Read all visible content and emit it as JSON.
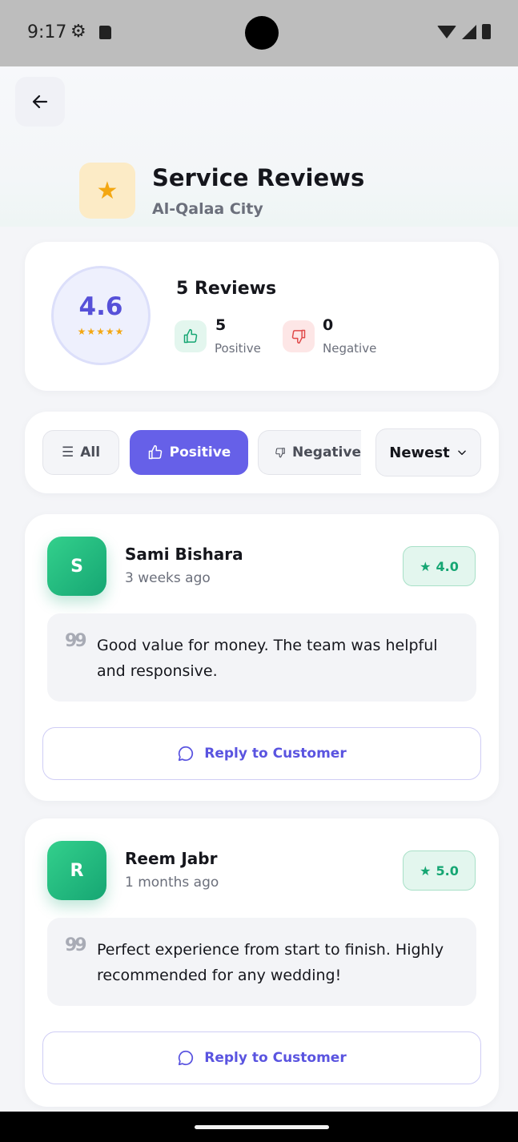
{
  "status_bar": {
    "time": "9:17"
  },
  "header": {
    "title": "Service Reviews",
    "subtitle": "Al-Qalaa City"
  },
  "summary": {
    "rating": "4.6",
    "stars": "★★★★★",
    "reviews_count": "5 Reviews",
    "positive_count": "5",
    "positive_label": "Positive",
    "negative_count": "0",
    "negative_label": "Negative"
  },
  "filters": {
    "all_label": "All",
    "positive_label": "Positive",
    "negative_label": "Negative",
    "sort_label": "Newest",
    "active": "Positive"
  },
  "reviews": [
    {
      "initial": "S",
      "name": "Sami Bishara",
      "time": "3 weeks ago",
      "rating": "4.0",
      "comment": "Good value for money. The team was helpful and responsive.",
      "reply_label": "Reply to Customer"
    },
    {
      "initial": "R",
      "name": "Reem Jabr",
      "time": "1 months ago",
      "rating": "5.0",
      "comment": "Perfect experience from start to finish. Highly recommended for any wedding!",
      "reply_label": "Reply to Customer"
    }
  ],
  "colors": {
    "accent": "#6660e8",
    "positive": "#16a673",
    "negative": "#e04a4a",
    "star": "#f3a712"
  }
}
